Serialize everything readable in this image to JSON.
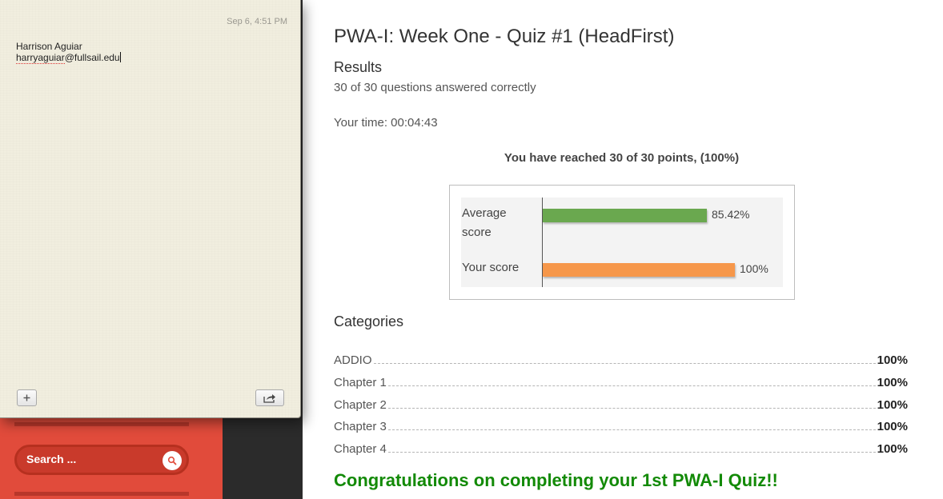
{
  "notes": {
    "date": "Sep 6, 4:51 PM",
    "name": "Harrison Aguiar",
    "email_user": "harryaguiar",
    "email_domain": "@fullsail.edu",
    "add_icon": "plus-icon",
    "share_icon": "share-icon"
  },
  "sidebar": {
    "search_placeholder": "Search ...",
    "accent_color": "#e14b3b"
  },
  "quiz": {
    "title": "PWA-I: Week One - Quiz #1 (HeadFirst)",
    "results_heading": "Results",
    "answered_text": "30 of 30 questions answered correctly",
    "time_text": "Your time: 00:04:43",
    "reached_text": "You have reached 30 of 30 points, (100%)",
    "categories_heading": "Categories",
    "categories": [
      {
        "name": "ADDIO",
        "value": "100%"
      },
      {
        "name": "Chapter 1",
        "value": "100%"
      },
      {
        "name": "Chapter 2",
        "value": "100%"
      },
      {
        "name": "Chapter 3",
        "value": "100%"
      },
      {
        "name": "Chapter 4",
        "value": "100%"
      }
    ],
    "congrats": "Congratulations on completing your 1st PWA-I Quiz!!"
  },
  "chart_data": {
    "type": "bar",
    "orientation": "horizontal",
    "categories": [
      "Average score",
      "Your score"
    ],
    "values": [
      85.42,
      100
    ],
    "value_labels": [
      "85.42%",
      "100%"
    ],
    "colors": [
      "#6aa84f",
      "#f6974a"
    ],
    "xlim": [
      0,
      100
    ],
    "grid": false
  }
}
